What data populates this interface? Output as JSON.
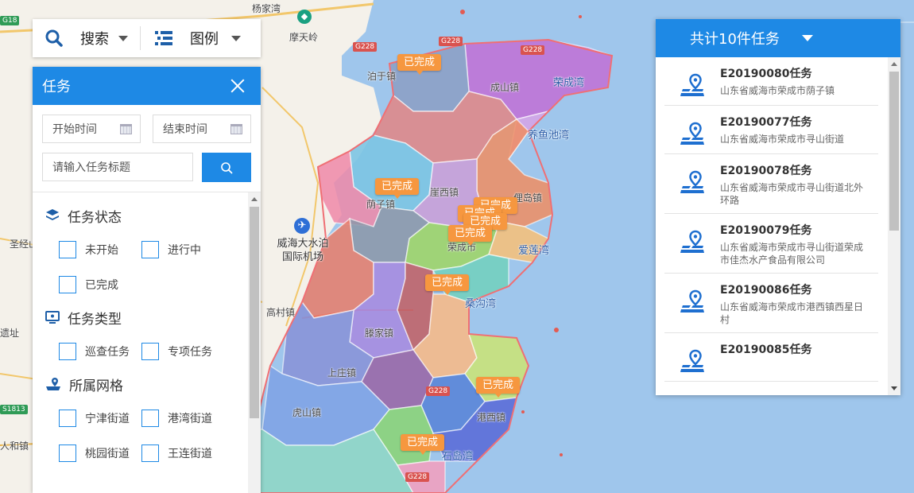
{
  "map": {
    "place_labels": [
      "杨家湾",
      "摩天岭",
      "泊于镇",
      "成山镇",
      "荣成湾",
      "养鱼池湾",
      "崖西镇",
      "俚岛镇",
      "荫子镇",
      "爱莲湾",
      "荣成市",
      "桑沟湾",
      "高村镇",
      "滕家镇",
      "上庄镇",
      "虎山镇",
      "圣经山",
      "遗址",
      "人和镇",
      "石岛湾",
      "港西镇"
    ],
    "airport_label": "威海大水泊国际机场",
    "road_shields": [
      "G228",
      "G228",
      "G228",
      "G228",
      "G228",
      "S1813",
      "G18"
    ],
    "completed_tag": "已完成",
    "completed_tags": [
      "已完成",
      "已完成",
      "已完成",
      "已完成",
      "已完成",
      "已完成",
      "已完成",
      "已完成",
      "已完成"
    ]
  },
  "topbar": {
    "search_label": "搜索",
    "legend_label": "图例"
  },
  "task_panel": {
    "title": "任务",
    "start_time_placeholder": "开始时间",
    "end_time_placeholder": "结束时间",
    "title_placeholder": "请输入任务标题",
    "sections": [
      {
        "title": "任务状态",
        "icon": "layers-icon",
        "options": [
          "未开始",
          "进行中",
          "已完成"
        ]
      },
      {
        "title": "任务类型",
        "icon": "monitor-icon",
        "options": [
          "巡查任务",
          "专项任务"
        ]
      },
      {
        "title": "所属网格",
        "icon": "grid-location-icon",
        "options": [
          "宁津街道",
          "港湾街道",
          "桃园街道",
          "王连街道"
        ]
      }
    ]
  },
  "task_list": {
    "header": "共计10件任务",
    "items": [
      {
        "name": "E20190080任务",
        "address": "山东省威海市荣成市荫子镇"
      },
      {
        "name": "E20190077任务",
        "address": "山东省威海市荣成市寻山街道"
      },
      {
        "name": "E20190078任务",
        "address": "山东省威海市荣成市寻山街道北外环路"
      },
      {
        "name": "E20190079任务",
        "address": "山东省威海市荣成市寻山街道荣成市佳杰水产食品有限公司"
      },
      {
        "name": "E20190086任务",
        "address": "山东省威海市荣成市港西镇西星日村"
      },
      {
        "name": "E20190085任务",
        "address": ""
      }
    ]
  },
  "colors": {
    "primary": "#1e89e5",
    "completed_tag": "#f6973f",
    "sea": "#9fc6ec",
    "land": "#f4f1ea"
  }
}
